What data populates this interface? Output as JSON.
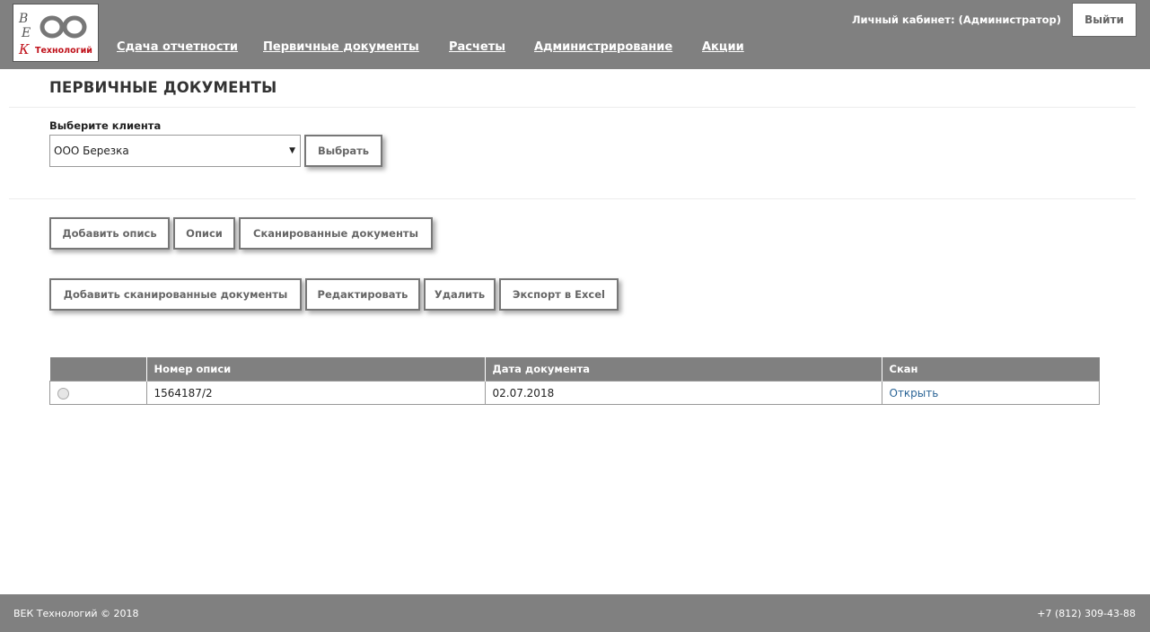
{
  "header": {
    "logo": {
      "letter_top": "В",
      "letter_mid": "Е",
      "letter_bot": "К",
      "text": "Технологий"
    },
    "nav": [
      {
        "label": "Сдача отчетности"
      },
      {
        "label": "Первичные документы"
      },
      {
        "label": "Расчеты"
      },
      {
        "label": "Администрирование"
      },
      {
        "label": "Акции"
      }
    ],
    "user_label": "Личный кабинет: (Администратор)",
    "logout_label": "Выйти"
  },
  "page": {
    "title": "ПЕРВИЧНЫЕ ДОКУМЕНТЫ",
    "client_label": "Выберите клиента",
    "client_value": "ООО Березка",
    "select_button": "Выбрать"
  },
  "toolbar1": [
    "Добавить опись",
    "Описи",
    "Сканированные документы"
  ],
  "toolbar2": [
    "Добавить сканированные документы",
    "Редактировать",
    "Удалить",
    "Экспорт в Excel"
  ],
  "table": {
    "columns": [
      "",
      "Номер описи",
      "Дата документа",
      "Скан"
    ],
    "rows": [
      {
        "number": "1564187/2",
        "date": "02.07.2018",
        "scan": "Открыть"
      }
    ]
  },
  "footer": {
    "copyright": "ВЕК Технологий © 2018",
    "phone": "+7 (812) 309-43-88"
  },
  "colors": {
    "header_bg": "#808080",
    "link": "#2a6496",
    "logo_red": "#c0121b"
  }
}
